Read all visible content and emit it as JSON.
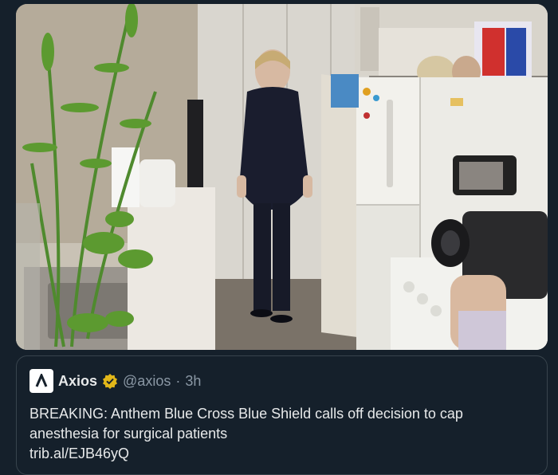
{
  "photo": {
    "description": ""
  },
  "quote_tweet": {
    "author_name": "Axios",
    "handle": "@axios",
    "separator": "·",
    "time": "3h",
    "text": "BREAKING: Anthem Blue Cross Blue Shield calls off decision to cap anesthesia for surgical patients",
    "link": "trib.al/EJB46yQ",
    "icons": {
      "avatar": "axios-logo-icon",
      "badge": "verified-badge-icon"
    },
    "colors": {
      "background": "#15202b",
      "border": "#38444d",
      "badge": "#e2b719",
      "text": "#e7e9ea",
      "muted": "#8b98a5"
    }
  }
}
